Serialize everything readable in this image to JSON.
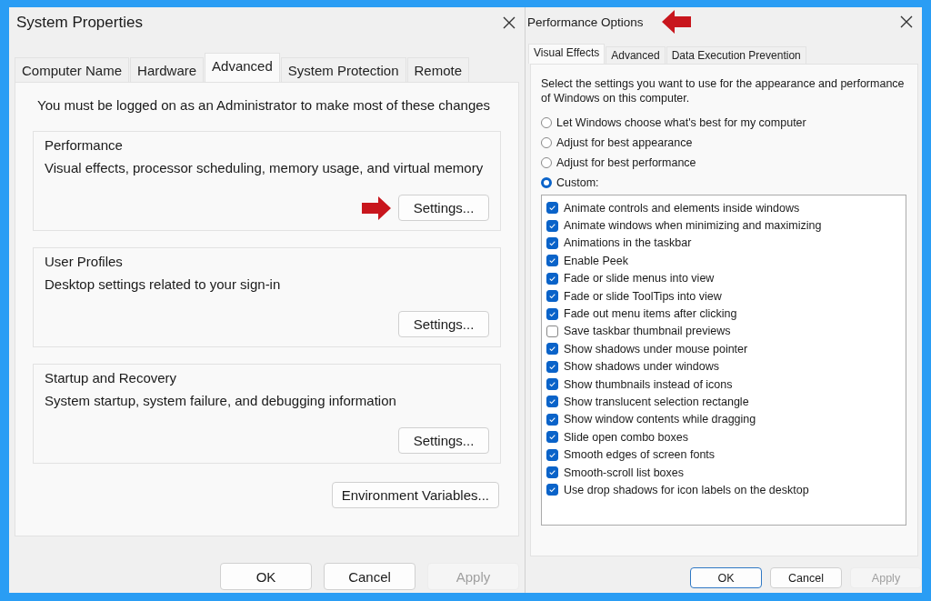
{
  "system_properties": {
    "title": "System Properties",
    "tabs": [
      {
        "label": "Computer Name",
        "selected": false
      },
      {
        "label": "Hardware",
        "selected": false
      },
      {
        "label": "Advanced",
        "selected": true
      },
      {
        "label": "System Protection",
        "selected": false
      },
      {
        "label": "Remote",
        "selected": false
      }
    ],
    "notice": "You must be logged on as an Administrator to make most of these changes",
    "groups": [
      {
        "title": "Performance",
        "description": "Visual effects, processor scheduling, memory usage, and virtual memory",
        "button": "Settings..."
      },
      {
        "title": "User Profiles",
        "description": "Desktop settings related to your sign-in",
        "button": "Settings..."
      },
      {
        "title": "Startup and Recovery",
        "description": "System startup, system failure, and debugging information",
        "button": "Settings..."
      }
    ],
    "env_button": "Environment Variables...",
    "buttons": [
      {
        "label": "OK",
        "disabled": false,
        "default": false
      },
      {
        "label": "Cancel",
        "disabled": false,
        "default": false
      },
      {
        "label": "Apply",
        "disabled": true,
        "default": false
      }
    ]
  },
  "performance_options": {
    "title": "Performance Options",
    "tabs": [
      {
        "label": "Visual Effects",
        "selected": true
      },
      {
        "label": "Advanced",
        "selected": false
      },
      {
        "label": "Data Execution Prevention",
        "selected": false
      }
    ],
    "intro": "Select the settings you want to use for the appearance and performance of Windows on this computer.",
    "options": [
      {
        "label": "Let Windows choose what's best for my computer",
        "selected": false
      },
      {
        "label": "Adjust for best appearance",
        "selected": false
      },
      {
        "label": "Adjust for best performance",
        "selected": false
      },
      {
        "label": "Custom:",
        "selected": true
      }
    ],
    "effects": [
      {
        "label": "Animate controls and elements inside windows",
        "checked": true
      },
      {
        "label": "Animate windows when minimizing and maximizing",
        "checked": true
      },
      {
        "label": "Animations in the taskbar",
        "checked": true
      },
      {
        "label": "Enable Peek",
        "checked": true
      },
      {
        "label": "Fade or slide menus into view",
        "checked": true
      },
      {
        "label": "Fade or slide ToolTips into view",
        "checked": true
      },
      {
        "label": "Fade out menu items after clicking",
        "checked": true
      },
      {
        "label": "Save taskbar thumbnail previews",
        "checked": false
      },
      {
        "label": "Show shadows under mouse pointer",
        "checked": true
      },
      {
        "label": "Show shadows under windows",
        "checked": true
      },
      {
        "label": "Show thumbnails instead of icons",
        "checked": true
      },
      {
        "label": "Show translucent selection rectangle",
        "checked": true
      },
      {
        "label": "Show window contents while dragging",
        "checked": true
      },
      {
        "label": "Slide open combo boxes",
        "checked": true
      },
      {
        "label": "Smooth edges of screen fonts",
        "checked": true
      },
      {
        "label": "Smooth-scroll list boxes",
        "checked": true
      },
      {
        "label": "Use drop shadows for icon labels on the desktop",
        "checked": true
      }
    ],
    "buttons": [
      {
        "label": "OK",
        "disabled": false,
        "default": true
      },
      {
        "label": "Cancel",
        "disabled": false,
        "default": false
      },
      {
        "label": "Apply",
        "disabled": true,
        "default": false
      }
    ]
  }
}
